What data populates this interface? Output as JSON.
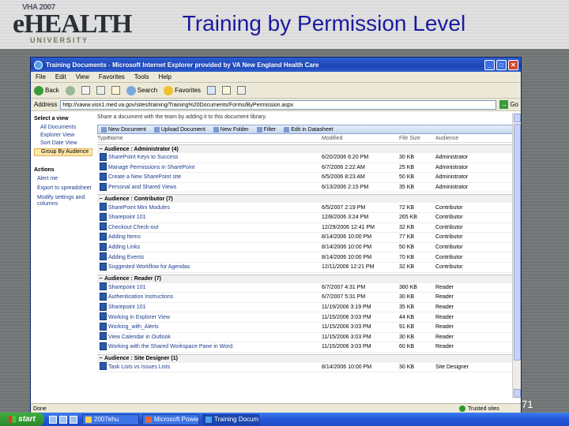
{
  "slide": {
    "title": "Training by Permission Level",
    "page_number": "71",
    "logo": {
      "year": "VHA 2007",
      "brand": "eHEALTH",
      "sub": "UNIVERSITY"
    }
  },
  "ie": {
    "window_title": "Training Documents - Microsoft Internet Explorer provided by VA New England Health Care",
    "menu": [
      "File",
      "Edit",
      "View",
      "Favorites",
      "Tools",
      "Help"
    ],
    "toolbar": {
      "back": "Back",
      "search": "Search",
      "favorites": "Favorites"
    },
    "address_label": "Address",
    "address_value": "http://vaww.visn1.med.va.gov/sites/training/Training%20Documents/Forms/ByPermission.aspx",
    "go_label": "Go",
    "status_text": "Done",
    "zone_text": "Trusted sites"
  },
  "leftnav": {
    "select_view_label": "Select a view",
    "views": [
      "All Documents",
      "Explorer View",
      "Sort Date View",
      "Group By Audience"
    ],
    "actions_label": "Actions",
    "actions": [
      "Alert me",
      "Export to spreadsheet",
      "Modify settings and columns"
    ]
  },
  "main": {
    "description": "Share a document with the team by adding it to this document library.",
    "listbar": {
      "new_document": "New Document",
      "upload_document": "Upload Document",
      "new_folder": "New Folder",
      "filter": "Filter",
      "edit_datasheet": "Edit in Datasheet"
    },
    "columns": {
      "type": "Type",
      "name": "Name",
      "modified": "Modified",
      "size": "File Size",
      "audience": "Audience"
    },
    "groups": [
      {
        "label": "Audience : Administrator (4)",
        "rows": [
          {
            "name": "SharePoint Keys to Success",
            "modified": "6/20/2006 6:20 PM",
            "size": "30 KB",
            "audience": "Administrator"
          },
          {
            "name": "Manage Permissions in SharePoint",
            "modified": "6/7/2006 2:22 AM",
            "size": "25 KB",
            "audience": "Administrator"
          },
          {
            "name": "Create a New SharePoint site",
            "modified": "6/5/2006 8:23 AM",
            "size": "50 KB",
            "audience": "Administrator"
          },
          {
            "name": "Personal and Shared Views",
            "modified": "6/13/2006 2:15 PM",
            "size": "35 KB",
            "audience": "Administrator"
          }
        ]
      },
      {
        "label": "Audience : Contributor (7)",
        "rows": [
          {
            "name": "SharePoint Mini Modules",
            "modified": "6/5/2007 2:19 PM",
            "size": "72 KB",
            "audience": "Contributor"
          },
          {
            "name": "Sharepoint 101",
            "modified": "12/8/2006 3:24 PM",
            "size": "265 KB",
            "audience": "Contributor"
          },
          {
            "name": "Checkout Check-out",
            "modified": "12/29/2006 12:41 PM",
            "size": "32 KB",
            "audience": "Contributor"
          },
          {
            "name": "Adding Items",
            "modified": "8/14/2006 10:00 PM",
            "size": "77 KB",
            "audience": "Contributor"
          },
          {
            "name": "Adding Links",
            "modified": "8/14/2006 10:00 PM",
            "size": "50 KB",
            "audience": "Contributor"
          },
          {
            "name": "Adding Events",
            "modified": "8/14/2006 10:00 PM",
            "size": "70 KB",
            "audience": "Contributor"
          },
          {
            "name": "Suggested Workflow for Agendas",
            "modified": "12/11/2006 12:21 PM",
            "size": "32 KB",
            "audience": "Contributor"
          }
        ]
      },
      {
        "label": "Audience : Reader (7)",
        "rows": [
          {
            "name": "Sharepoint 101",
            "modified": "6/7/2007 4:31 PM",
            "size": "380 KB",
            "audience": "Reader"
          },
          {
            "name": "Authentication Instructions",
            "modified": "6/7/2007 5:31 PM",
            "size": "30 KB",
            "audience": "Reader"
          },
          {
            "name": "Sharepoint 101",
            "modified": "11/19/2006 3:19 PM",
            "size": "35 KB",
            "audience": "Reader"
          },
          {
            "name": "Working in Explorer View",
            "modified": "11/15/2006 3:03 PM",
            "size": "44 KB",
            "audience": "Reader"
          },
          {
            "name": "Working_with_Alerts",
            "modified": "11/15/2006 3:03 PM",
            "size": "91 KB",
            "audience": "Reader"
          },
          {
            "name": "View Calendar in Outlook",
            "modified": "11/15/2006 3:03 PM",
            "size": "30 KB",
            "audience": "Reader"
          },
          {
            "name": "Working with the Shared Workspace Pane in Word.",
            "modified": "11/15/2006 3:03 PM",
            "size": "60 KB",
            "audience": "Reader"
          }
        ]
      },
      {
        "label": "Audience : Site Designer (1)",
        "rows": [
          {
            "name": "Task Lists vs Issues Lists",
            "modified": "8/14/2006 10:00 PM",
            "size": "30 KB",
            "audience": "Site Designer"
          }
        ]
      }
    ]
  },
  "taskbar": {
    "start_label": "start",
    "tasks": [
      "2007ehu",
      "Microsoft PowerPoint ...",
      "Training Documents ..."
    ]
  }
}
